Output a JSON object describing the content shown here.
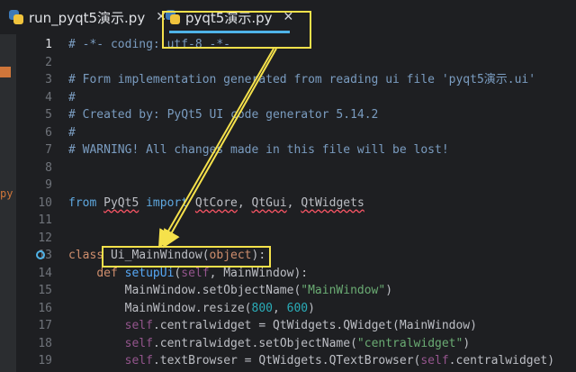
{
  "tabs": [
    {
      "label": "run_pyqt5演示.py",
      "active": false
    },
    {
      "label": "pyqt5演示.py",
      "active": true
    }
  ],
  "left_fragment": "py",
  "lines": [
    {
      "n": "1",
      "segs": [
        [
          "com",
          "# -*- coding: utf-8 -*-"
        ]
      ]
    },
    {
      "n": "2",
      "segs": []
    },
    {
      "n": "3",
      "segs": [
        [
          "com",
          "# Form implementation generated from reading ui file 'pyqt5演示.ui'"
        ]
      ]
    },
    {
      "n": "4",
      "segs": [
        [
          "com",
          "#"
        ]
      ]
    },
    {
      "n": "5",
      "segs": [
        [
          "com",
          "# Created by: PyQt5 UI code generator 5.14.2"
        ]
      ]
    },
    {
      "n": "6",
      "segs": [
        [
          "com",
          "#"
        ]
      ]
    },
    {
      "n": "7",
      "segs": [
        [
          "com",
          "# WARNING! All changes made in this file will be lost!"
        ]
      ]
    },
    {
      "n": "8",
      "segs": []
    },
    {
      "n": "9",
      "segs": []
    },
    {
      "n": "10",
      "segs": [
        [
          "kwb",
          "from "
        ],
        [
          "ul",
          "PyQt5"
        ],
        [
          "kwb",
          " import "
        ],
        [
          "ul",
          "QtCore"
        ],
        [
          "txt",
          ", "
        ],
        [
          "ul",
          "QtGui"
        ],
        [
          "txt",
          ", "
        ],
        [
          "ul",
          "QtWidgets"
        ]
      ]
    },
    {
      "n": "11",
      "segs": []
    },
    {
      "n": "12",
      "segs": []
    },
    {
      "n": "13",
      "segs": [
        [
          "kw",
          "class "
        ],
        [
          "txt",
          "Ui_MainWindow("
        ],
        [
          "kw",
          "object"
        ],
        [
          "txt",
          "):"
        ]
      ]
    },
    {
      "n": "14",
      "segs": [
        [
          "txt",
          "    "
        ],
        [
          "kw",
          "def "
        ],
        [
          "def",
          "setupUi"
        ],
        [
          "txt",
          "("
        ],
        [
          "self",
          "self"
        ],
        [
          "txt",
          ", MainWindow):"
        ]
      ]
    },
    {
      "n": "15",
      "segs": [
        [
          "txt",
          "        MainWindow.setObjectName("
        ],
        [
          "str",
          "\"MainWindow\""
        ],
        [
          "txt",
          ")"
        ]
      ]
    },
    {
      "n": "16",
      "segs": [
        [
          "txt",
          "        MainWindow.resize("
        ],
        [
          "num",
          "800"
        ],
        [
          "txt",
          ", "
        ],
        [
          "num",
          "600"
        ],
        [
          "txt",
          ")"
        ]
      ]
    },
    {
      "n": "17",
      "segs": [
        [
          "txt",
          "        "
        ],
        [
          "self",
          "self"
        ],
        [
          "txt",
          ".centralwidget = QtWidgets.QWidget(MainWindow)"
        ]
      ]
    },
    {
      "n": "18",
      "segs": [
        [
          "txt",
          "        "
        ],
        [
          "self",
          "self"
        ],
        [
          "txt",
          ".centralwidget.setObjectName("
        ],
        [
          "str",
          "\"centralwidget\""
        ],
        [
          "txt",
          ")"
        ]
      ]
    },
    {
      "n": "19",
      "segs": [
        [
          "txt",
          "        "
        ],
        [
          "self",
          "self"
        ],
        [
          "txt",
          ".textBrowser = QtWidgets.QTextBrowser("
        ],
        [
          "self",
          "self"
        ],
        [
          "txt",
          ".centralwidget)"
        ]
      ]
    }
  ],
  "colors": {
    "accent": "#4fb3e8",
    "annotation": "#f5e14b",
    "current_line": "#2d3c9a"
  }
}
